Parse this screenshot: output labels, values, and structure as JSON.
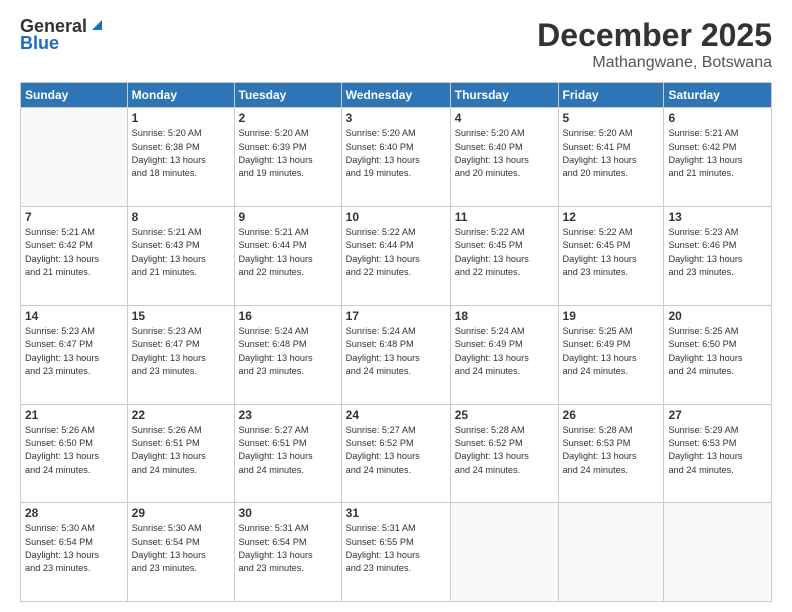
{
  "header": {
    "logo_general": "General",
    "logo_blue": "Blue",
    "month": "December 2025",
    "location": "Mathangwane, Botswana"
  },
  "days_of_week": [
    "Sunday",
    "Monday",
    "Tuesday",
    "Wednesday",
    "Thursday",
    "Friday",
    "Saturday"
  ],
  "weeks": [
    [
      {
        "day": "",
        "info": ""
      },
      {
        "day": "1",
        "info": "Sunrise: 5:20 AM\nSunset: 6:38 PM\nDaylight: 13 hours\nand 18 minutes."
      },
      {
        "day": "2",
        "info": "Sunrise: 5:20 AM\nSunset: 6:39 PM\nDaylight: 13 hours\nand 19 minutes."
      },
      {
        "day": "3",
        "info": "Sunrise: 5:20 AM\nSunset: 6:40 PM\nDaylight: 13 hours\nand 19 minutes."
      },
      {
        "day": "4",
        "info": "Sunrise: 5:20 AM\nSunset: 6:40 PM\nDaylight: 13 hours\nand 20 minutes."
      },
      {
        "day": "5",
        "info": "Sunrise: 5:20 AM\nSunset: 6:41 PM\nDaylight: 13 hours\nand 20 minutes."
      },
      {
        "day": "6",
        "info": "Sunrise: 5:21 AM\nSunset: 6:42 PM\nDaylight: 13 hours\nand 21 minutes."
      }
    ],
    [
      {
        "day": "7",
        "info": "Sunrise: 5:21 AM\nSunset: 6:42 PM\nDaylight: 13 hours\nand 21 minutes."
      },
      {
        "day": "8",
        "info": "Sunrise: 5:21 AM\nSunset: 6:43 PM\nDaylight: 13 hours\nand 21 minutes."
      },
      {
        "day": "9",
        "info": "Sunrise: 5:21 AM\nSunset: 6:44 PM\nDaylight: 13 hours\nand 22 minutes."
      },
      {
        "day": "10",
        "info": "Sunrise: 5:22 AM\nSunset: 6:44 PM\nDaylight: 13 hours\nand 22 minutes."
      },
      {
        "day": "11",
        "info": "Sunrise: 5:22 AM\nSunset: 6:45 PM\nDaylight: 13 hours\nand 22 minutes."
      },
      {
        "day": "12",
        "info": "Sunrise: 5:22 AM\nSunset: 6:45 PM\nDaylight: 13 hours\nand 23 minutes."
      },
      {
        "day": "13",
        "info": "Sunrise: 5:23 AM\nSunset: 6:46 PM\nDaylight: 13 hours\nand 23 minutes."
      }
    ],
    [
      {
        "day": "14",
        "info": "Sunrise: 5:23 AM\nSunset: 6:47 PM\nDaylight: 13 hours\nand 23 minutes."
      },
      {
        "day": "15",
        "info": "Sunrise: 5:23 AM\nSunset: 6:47 PM\nDaylight: 13 hours\nand 23 minutes."
      },
      {
        "day": "16",
        "info": "Sunrise: 5:24 AM\nSunset: 6:48 PM\nDaylight: 13 hours\nand 23 minutes."
      },
      {
        "day": "17",
        "info": "Sunrise: 5:24 AM\nSunset: 6:48 PM\nDaylight: 13 hours\nand 24 minutes."
      },
      {
        "day": "18",
        "info": "Sunrise: 5:24 AM\nSunset: 6:49 PM\nDaylight: 13 hours\nand 24 minutes."
      },
      {
        "day": "19",
        "info": "Sunrise: 5:25 AM\nSunset: 6:49 PM\nDaylight: 13 hours\nand 24 minutes."
      },
      {
        "day": "20",
        "info": "Sunrise: 5:25 AM\nSunset: 6:50 PM\nDaylight: 13 hours\nand 24 minutes."
      }
    ],
    [
      {
        "day": "21",
        "info": "Sunrise: 5:26 AM\nSunset: 6:50 PM\nDaylight: 13 hours\nand 24 minutes."
      },
      {
        "day": "22",
        "info": "Sunrise: 5:26 AM\nSunset: 6:51 PM\nDaylight: 13 hours\nand 24 minutes."
      },
      {
        "day": "23",
        "info": "Sunrise: 5:27 AM\nSunset: 6:51 PM\nDaylight: 13 hours\nand 24 minutes."
      },
      {
        "day": "24",
        "info": "Sunrise: 5:27 AM\nSunset: 6:52 PM\nDaylight: 13 hours\nand 24 minutes."
      },
      {
        "day": "25",
        "info": "Sunrise: 5:28 AM\nSunset: 6:52 PM\nDaylight: 13 hours\nand 24 minutes."
      },
      {
        "day": "26",
        "info": "Sunrise: 5:28 AM\nSunset: 6:53 PM\nDaylight: 13 hours\nand 24 minutes."
      },
      {
        "day": "27",
        "info": "Sunrise: 5:29 AM\nSunset: 6:53 PM\nDaylight: 13 hours\nand 24 minutes."
      }
    ],
    [
      {
        "day": "28",
        "info": "Sunrise: 5:30 AM\nSunset: 6:54 PM\nDaylight: 13 hours\nand 23 minutes."
      },
      {
        "day": "29",
        "info": "Sunrise: 5:30 AM\nSunset: 6:54 PM\nDaylight: 13 hours\nand 23 minutes."
      },
      {
        "day": "30",
        "info": "Sunrise: 5:31 AM\nSunset: 6:54 PM\nDaylight: 13 hours\nand 23 minutes."
      },
      {
        "day": "31",
        "info": "Sunrise: 5:31 AM\nSunset: 6:55 PM\nDaylight: 13 hours\nand 23 minutes."
      },
      {
        "day": "",
        "info": ""
      },
      {
        "day": "",
        "info": ""
      },
      {
        "day": "",
        "info": ""
      }
    ]
  ]
}
